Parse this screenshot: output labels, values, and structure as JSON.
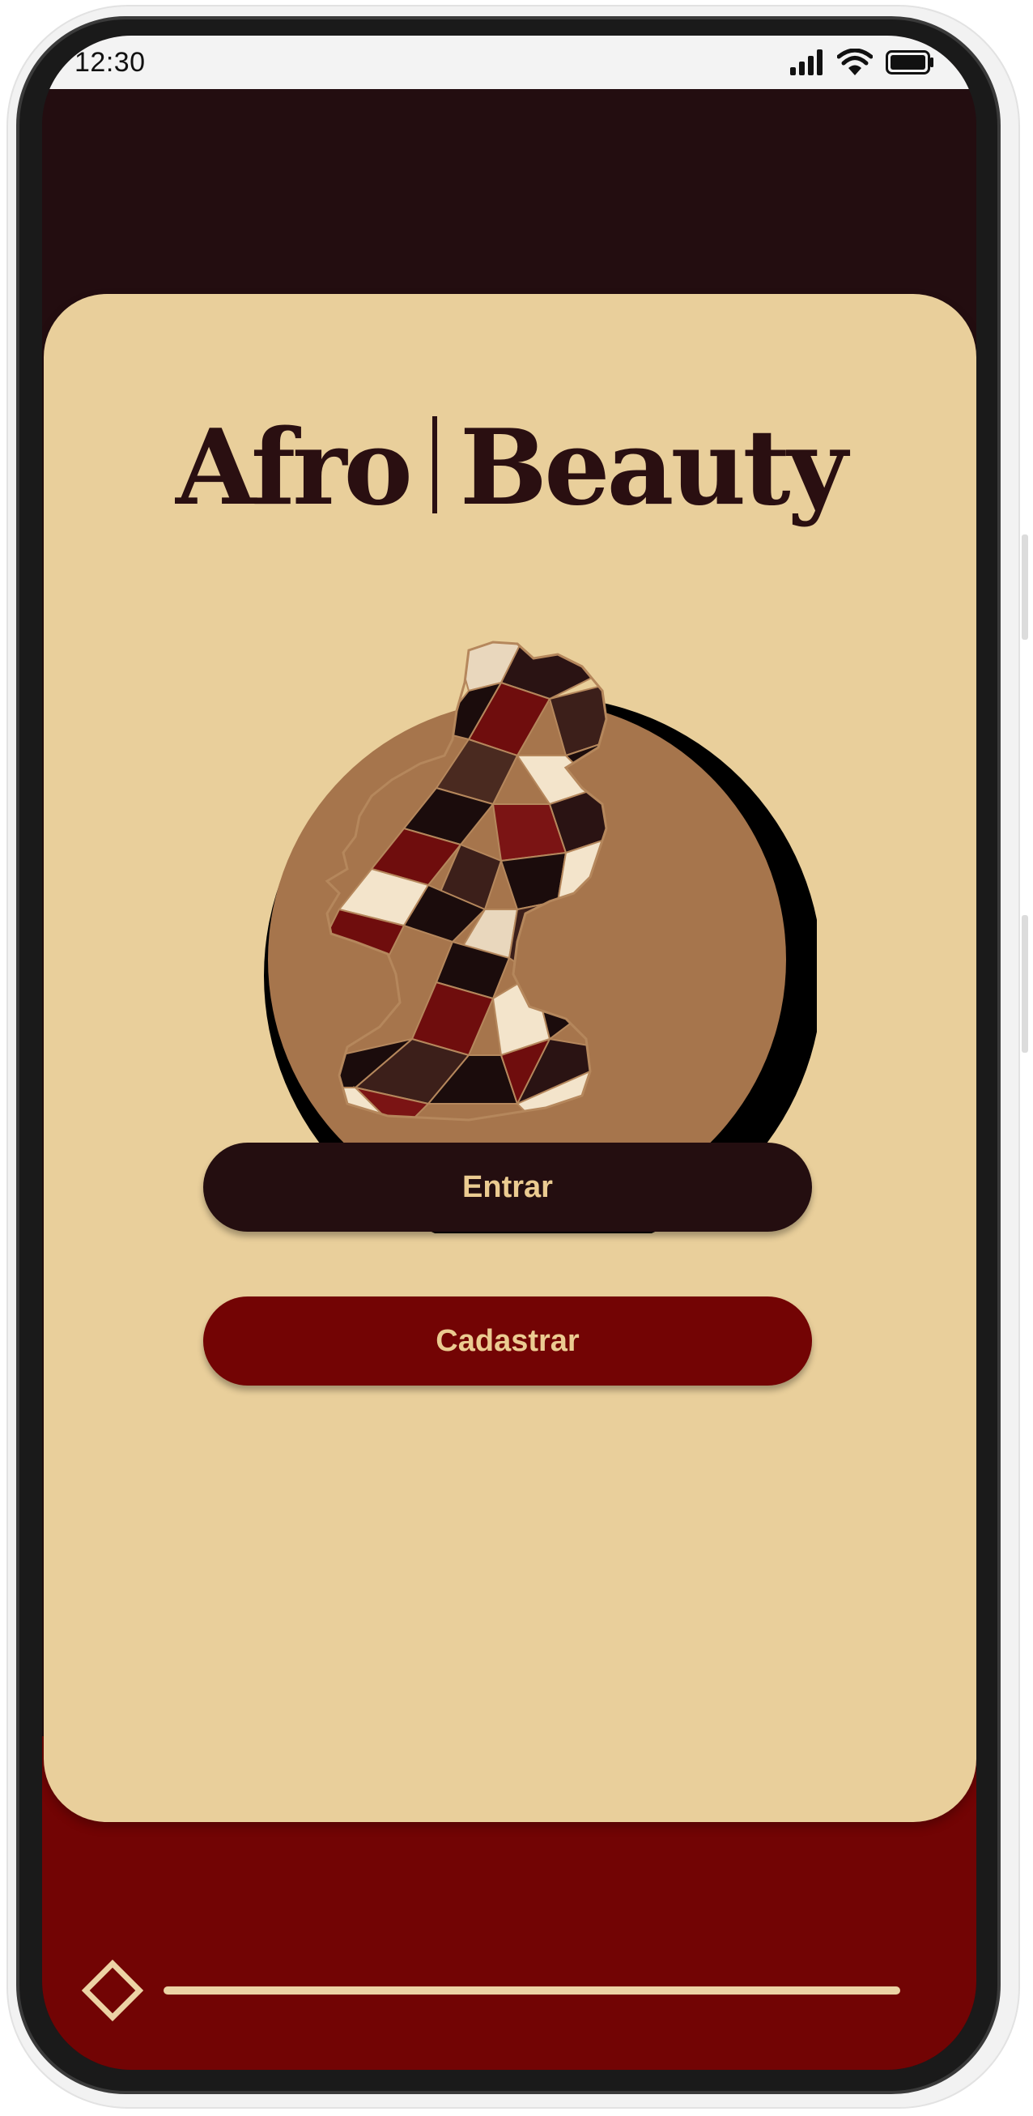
{
  "status_bar": {
    "time": "12:30"
  },
  "app": {
    "title_left": "Afro",
    "title_right": "Beauty"
  },
  "buttons": {
    "login_label": "Entrar",
    "register_label": "Cadastrar"
  },
  "colors": {
    "dark_brown": "#230d10",
    "burgundy": "#720404",
    "sand": "#e9cf9b",
    "cream": "#ecd3a5",
    "tan": "#a6754c"
  },
  "icons": {
    "signal": "signal-icon",
    "wifi": "wifi-icon",
    "battery": "battery-icon",
    "logo": "afro-woman-silhouette-logo",
    "slider_thumb": "diamond-icon"
  }
}
